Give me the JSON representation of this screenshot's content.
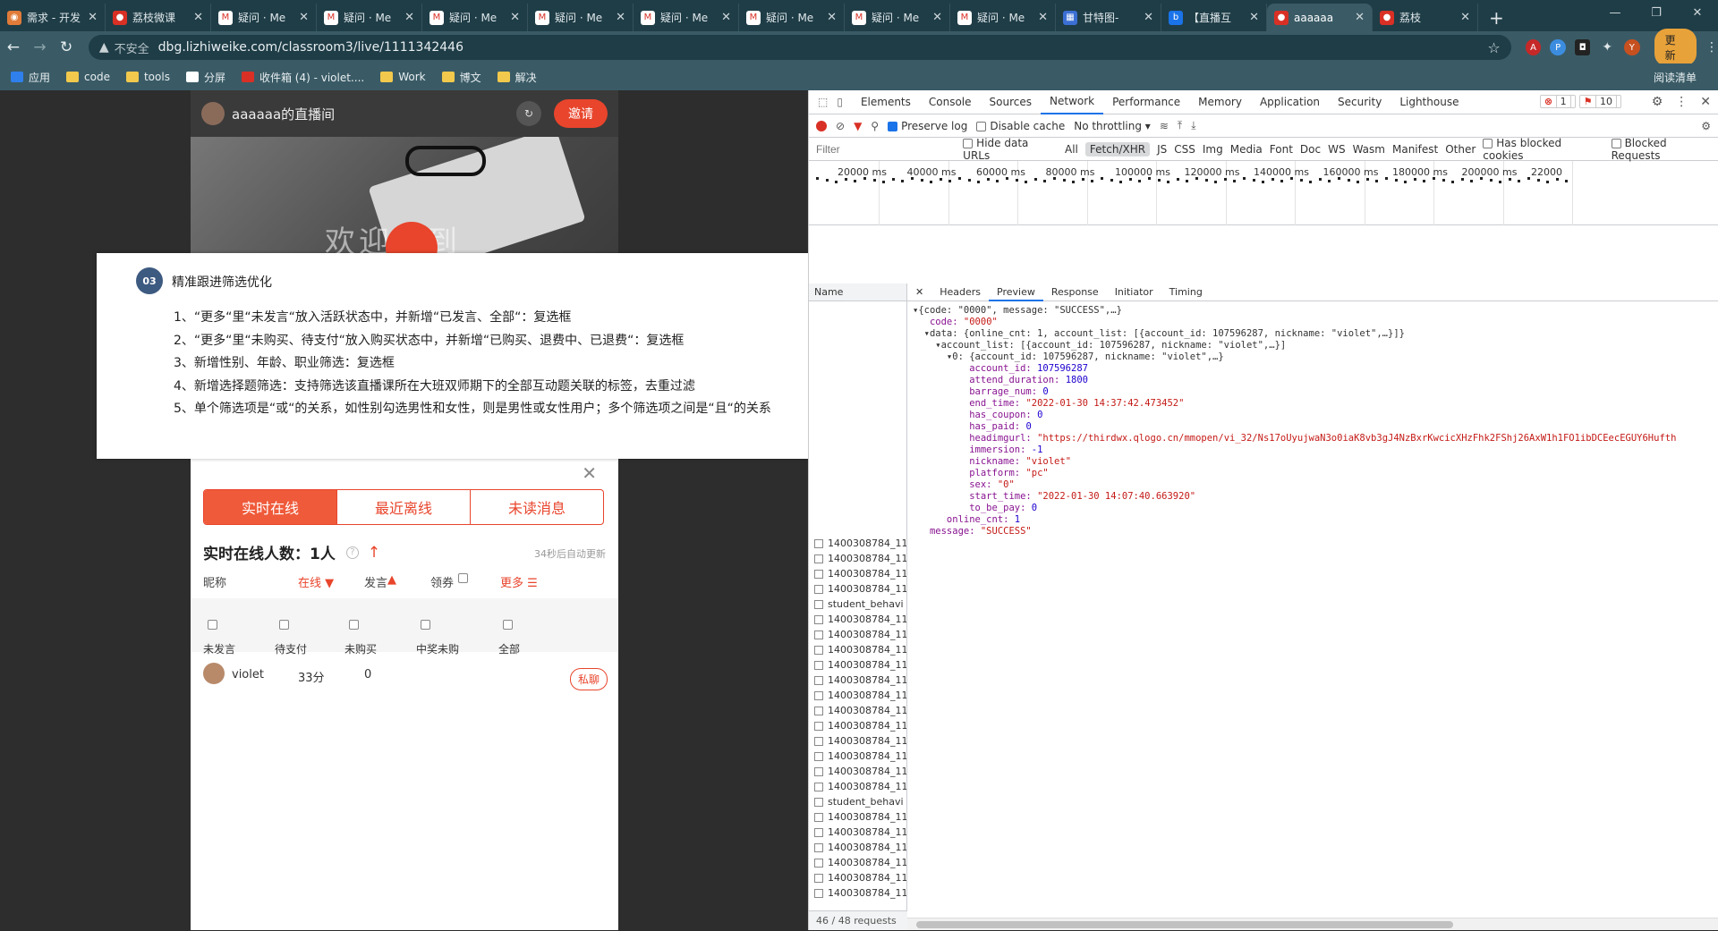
{
  "browser": {
    "tabs": [
      {
        "title": "需求 - 开发",
        "color": "#e07b39",
        "glyph": "◉"
      },
      {
        "title": "荔枝微课",
        "color": "#d93025",
        "glyph": "●"
      },
      {
        "title": "疑问 · Me",
        "color": "#ffffff",
        "glyph": "M"
      },
      {
        "title": "疑问 · Me",
        "color": "#ffffff",
        "glyph": "M"
      },
      {
        "title": "疑问 · Me",
        "color": "#ffffff",
        "glyph": "M"
      },
      {
        "title": "疑问 · Me",
        "color": "#ffffff",
        "glyph": "M"
      },
      {
        "title": "疑问 · Me",
        "color": "#ffffff",
        "glyph": "M"
      },
      {
        "title": "疑问 · Me",
        "color": "#ffffff",
        "glyph": "M"
      },
      {
        "title": "疑问 · Me",
        "color": "#ffffff",
        "glyph": "M"
      },
      {
        "title": "疑问 · Me",
        "color": "#ffffff",
        "glyph": "M"
      },
      {
        "title": "甘特图-",
        "color": "#3b6fd4",
        "glyph": "▦"
      },
      {
        "title": "【直播互",
        "color": "#1a73e8",
        "glyph": "b"
      },
      {
        "title": "aaaaaa",
        "color": "#d93025",
        "glyph": "●"
      },
      {
        "title": "荔枝",
        "color": "#d93025",
        "glyph": "●"
      }
    ],
    "active_tab": 12,
    "new_tab": "+",
    "security": "不安全",
    "url": "dbg.lizhiweike.com/classroom3/live/1111342446",
    "update_label": "更新",
    "profile_letter": "Y",
    "bookmarks": [
      "应用",
      "code",
      "tools",
      "分屏",
      "收件箱 (4) - violet....",
      "Work",
      "博文",
      "解决"
    ],
    "reading_list": "阅读清单"
  },
  "live": {
    "room_name": "aaaaaa的直播间",
    "invite": "邀请",
    "welcome": "欢迎来到",
    "tabs": [
      "实时在线",
      "最近离线",
      "未读消息"
    ],
    "online_label": "实时在线人数：1人",
    "auto_update": "34秒后自动更新",
    "cols": {
      "nick": "昵称",
      "online": "在线",
      "speak": "发言",
      "coupon": "领券",
      "more": "更多"
    },
    "filters": [
      "未发言",
      "待支付",
      "未购买",
      "中奖未购",
      "全部"
    ],
    "user": {
      "name": "violet",
      "duration": "33分",
      "count": "0",
      "chat": "私聊"
    }
  },
  "card": {
    "num": "03",
    "title": "精准跟进筛选优化",
    "items": [
      "1、“更多“里“未发言“放入活跃状态中，并新增“已发言、全部“：复选框",
      "2、“更多“里“未购买、待支付“放入购买状态中，并新增“已购买、退费中、已退费“：复选框",
      "3、新增性别、年龄、职业筛选：复选框",
      "4、新增选择题筛选：支持筛选该直播课所在大班双师期下的全部互动题关联的标签，去重过滤",
      "5、单个筛选项是“或“的关系，如性别勾选男性和女性，则是男性或女性用户；多个筛选项之间是“且“的关系"
    ]
  },
  "devtools": {
    "tabs": [
      "Elements",
      "Console",
      "Sources",
      "Network",
      "Performance",
      "Memory",
      "Application",
      "Security",
      "Lighthouse"
    ],
    "active": "Network",
    "errors": "1",
    "warnings": "10",
    "preserve_log": "Preserve log",
    "disable_cache": "Disable cache",
    "throttle": "No throttling",
    "filter_placeholder": "Filter",
    "hide_data": "Hide data URLs",
    "types": [
      "All",
      "Fetch/XHR",
      "JS",
      "CSS",
      "Img",
      "Media",
      "Font",
      "Doc",
      "WS",
      "Wasm",
      "Manifest",
      "Other"
    ],
    "blocked_cookies": "Has blocked cookies",
    "blocked_req": "Blocked Requests",
    "ticks": [
      "20000 ms",
      "40000 ms",
      "60000 ms",
      "80000 ms",
      "100000 ms",
      "120000 ms",
      "140000 ms",
      "160000 ms",
      "180000 ms",
      "200000 ms",
      "22000"
    ],
    "name_header": "Name",
    "names": [
      "1400308784_11",
      "1400308784_11",
      "1400308784_11",
      "1400308784_11",
      "student_behavi",
      "1400308784_11",
      "1400308784_11",
      "1400308784_11",
      "1400308784_11",
      "1400308784_11",
      "1400308784_11",
      "1400308784_11",
      "1400308784_11",
      "1400308784_11",
      "1400308784_11",
      "1400308784_11",
      "1400308784_11",
      "student_behavi",
      "1400308784_11",
      "1400308784_11",
      "1400308784_11",
      "1400308784_11",
      "1400308784_11",
      "1400308784_11"
    ],
    "requests": "46 / 48 requests",
    "detail_tabs": [
      "Headers",
      "Preview",
      "Response",
      "Initiator",
      "Timing"
    ],
    "detail_active": "Preview",
    "json_lines": [
      [
        "▾{code: \"0000\", message: \"SUCCESS\",…}",
        ""
      ],
      [
        "   code: ",
        "\"0000\""
      ],
      [
        "  ▾data: {online_cnt: 1, account_list: [{account_id: 107596287, nickname: \"violet\",…}]}",
        ""
      ],
      [
        "    ▾account_list: [{account_id: 107596287, nickname: \"violet\",…}]",
        ""
      ],
      [
        "      ▾0: {account_id: 107596287, nickname: \"violet\",…}",
        ""
      ],
      [
        "          account_id: ",
        "107596287"
      ],
      [
        "          attend_duration: ",
        "1800"
      ],
      [
        "          barrage_num: ",
        "0"
      ],
      [
        "          end_time: ",
        "\"2022-01-30 14:37:42.473452\""
      ],
      [
        "          has_coupon: ",
        "0"
      ],
      [
        "          has_paid: ",
        "0"
      ],
      [
        "          headimgurl: ",
        "\"https://thirdwx.qlogo.cn/mmopen/vi_32/Ns17oUyujwaN3o0iaK8vb3gJ4NzBxrKwcicXHzFhk2FShj26AxW1h1FO1ibDCEecEGUY6Hufth"
      ],
      [
        "          immersion: ",
        "-1"
      ],
      [
        "          nickname: ",
        "\"violet\""
      ],
      [
        "          platform: ",
        "\"pc\""
      ],
      [
        "          sex: ",
        "\"0\""
      ],
      [
        "          start_time: ",
        "\"2022-01-30 14:07:40.663920\""
      ],
      [
        "          to_be_pay: ",
        "0"
      ],
      [
        "      online_cnt: ",
        "1"
      ],
      [
        "   message: ",
        "\"SUCCESS\""
      ]
    ]
  }
}
